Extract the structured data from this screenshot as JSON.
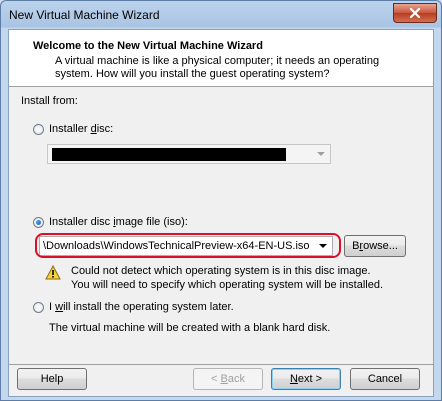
{
  "window": {
    "title": "New Virtual Machine Wizard",
    "close_icon": "close-icon"
  },
  "header": {
    "title": "Welcome to the New Virtual Machine Wizard",
    "description": "A virtual machine is like a physical computer; it needs an operating system. How will you install the guest operating system?"
  },
  "install": {
    "label": "Install from:",
    "disc": {
      "label_pre": "Installer ",
      "label_key": "d",
      "label_post": "isc:",
      "selected": false,
      "value_redacted": true
    },
    "iso": {
      "label_pre": "Installer disc ",
      "label_key": "i",
      "label_post": "mage file (iso):",
      "selected": true,
      "value": "\\Downloads\\WindowsTechnicalPreview-x64-EN-US.iso",
      "browse_pre": "B",
      "browse_key": "r",
      "browse_post": "owse...",
      "warning_icon": "warning-icon",
      "warning_line1": "Could not detect which operating system is in this disc image.",
      "warning_line2": "You will need to specify which operating system will be installed."
    },
    "later": {
      "label_pre": "I ",
      "label_key": "w",
      "label_post": "ill install the operating system later.",
      "selected": false,
      "note": "The virtual machine will be created with a blank hard disk."
    }
  },
  "footer": {
    "help": "Help",
    "back_key": "B",
    "back_post": "ack",
    "back_arrow": "<",
    "next_key": "N",
    "next_post": "ext >",
    "cancel": "Cancel"
  }
}
